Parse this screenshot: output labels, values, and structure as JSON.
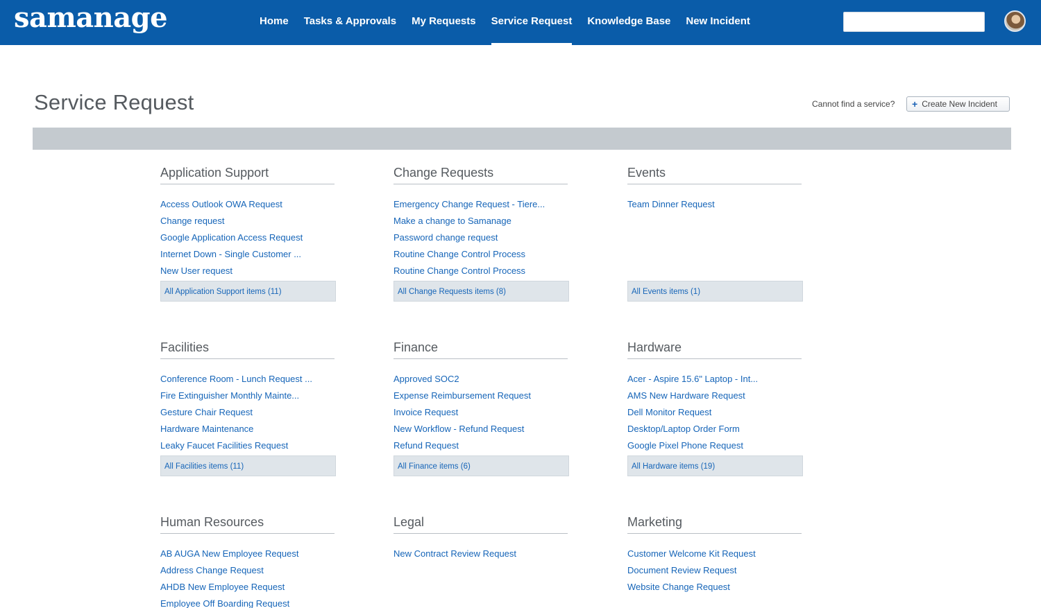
{
  "header": {
    "logo": "samanage",
    "nav": [
      {
        "label": "Home",
        "active": false
      },
      {
        "label": "Tasks & Approvals",
        "active": false
      },
      {
        "label": "My Requests",
        "active": false
      },
      {
        "label": "Service Request",
        "active": true
      },
      {
        "label": "Knowledge Base",
        "active": false
      },
      {
        "label": "New Incident",
        "active": false
      }
    ],
    "search_value": ""
  },
  "page": {
    "title": "Service Request",
    "cannot_find_text": "Cannot find a service?",
    "create_button": "Create New Incident"
  },
  "categories": [
    {
      "title": "Application Support",
      "items": [
        "Access Outlook OWA Request",
        "Change request",
        "Google Application Access Request",
        "Internet Down - Single Customer ...",
        "New User request"
      ],
      "all_link": "All Application Support items (11)"
    },
    {
      "title": "Change Requests",
      "items": [
        "Emergency Change Request - Tiere...",
        "Make a change to Samanage",
        "Password change request",
        "Routine Change Control Process",
        "Routine Change Control Process"
      ],
      "all_link": "All Change Requests items (8)"
    },
    {
      "title": "Events",
      "items": [
        "Team Dinner Request"
      ],
      "all_link": "All Events items (1)"
    },
    {
      "title": "Facilities",
      "items": [
        "Conference Room - Lunch Request ...",
        "Fire Extinguisher Monthly Mainte...",
        "Gesture Chair Request",
        "Hardware Maintenance",
        "Leaky Faucet Facilities Request"
      ],
      "all_link": "All Facilities items (11)"
    },
    {
      "title": "Finance",
      "items": [
        "Approved SOC2",
        "Expense Reimbursement Request",
        "Invoice Request",
        "New Workflow - Refund Request",
        "Refund Request"
      ],
      "all_link": "All Finance items (6)"
    },
    {
      "title": "Hardware",
      "items": [
        "Acer - Aspire 15.6\" Laptop - Int...",
        "AMS New Hardware Request",
        "Dell Monitor Request",
        "Desktop/Laptop Order Form",
        "Google Pixel Phone Request"
      ],
      "all_link": "All Hardware items (19)"
    },
    {
      "title": "Human Resources",
      "items": [
        "AB AUGA New Employee Request",
        "Address Change Request",
        "AHDB New Employee Request",
        "Employee Off Boarding Request"
      ],
      "all_link": ""
    },
    {
      "title": "Legal",
      "items": [
        "New Contract Review Request"
      ],
      "all_link": ""
    },
    {
      "title": "Marketing",
      "items": [
        "Customer Welcome Kit Request",
        "Document Review Request",
        "Website Change Request"
      ],
      "all_link": ""
    }
  ],
  "colors": {
    "brand_blue": "#0a5ca9",
    "link_blue": "#1665b8",
    "band_gray": "#c4cacf"
  }
}
